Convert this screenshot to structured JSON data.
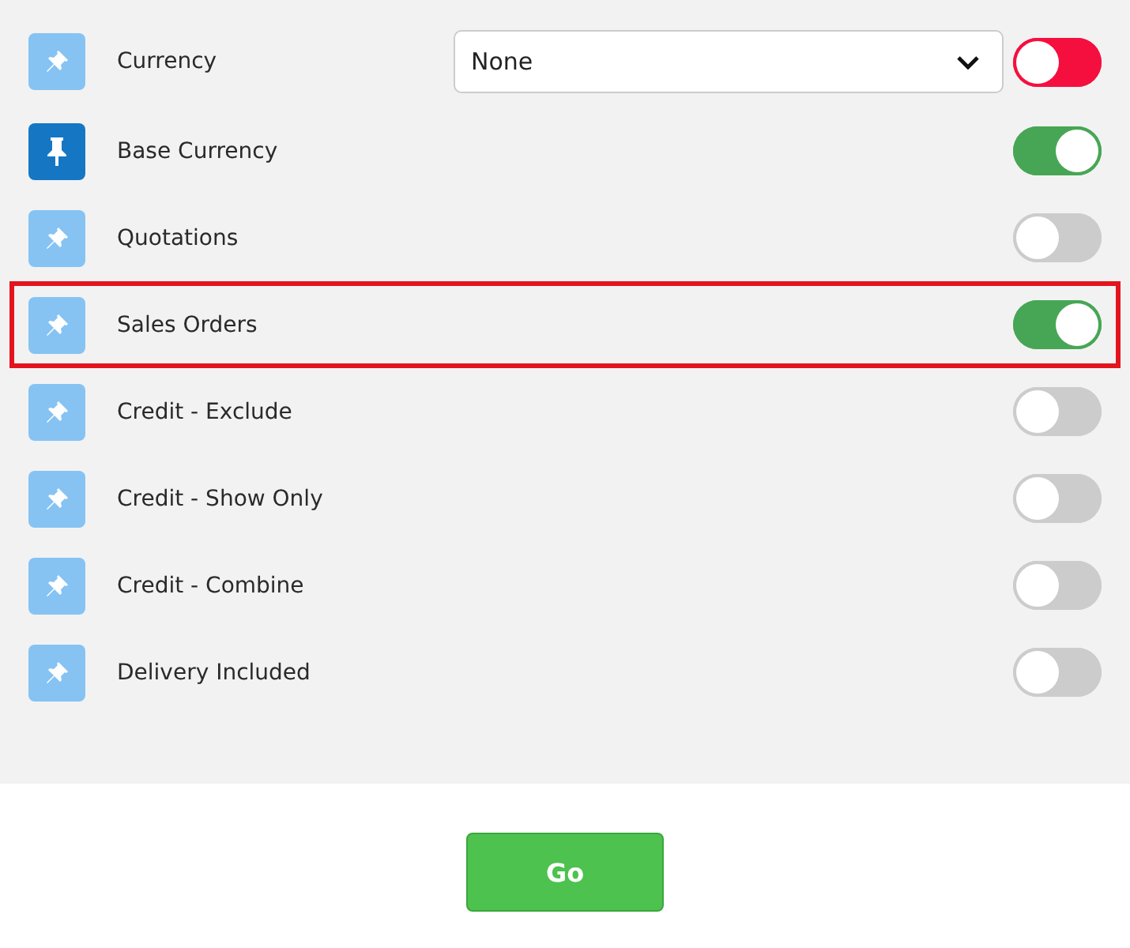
{
  "rows": [
    {
      "kind": "select",
      "label": "Currency",
      "pinned": false,
      "highlighted": false,
      "select": {
        "value": "None"
      },
      "on": false,
      "invalid": true
    },
    {
      "kind": "toggle",
      "label": "Base Currency",
      "pinned": true,
      "highlighted": false,
      "on": true,
      "invalid": false
    },
    {
      "kind": "toggle",
      "label": "Quotations",
      "pinned": false,
      "highlighted": false,
      "on": false,
      "invalid": false
    },
    {
      "kind": "toggle",
      "label": "Sales Orders",
      "pinned": false,
      "highlighted": true,
      "on": true,
      "invalid": false
    },
    {
      "kind": "toggle",
      "label": "Credit - Exclude",
      "pinned": false,
      "highlighted": false,
      "on": false,
      "invalid": false
    },
    {
      "kind": "toggle",
      "label": "Credit - Show Only",
      "pinned": false,
      "highlighted": false,
      "on": false,
      "invalid": false
    },
    {
      "kind": "toggle",
      "label": "Credit - Combine",
      "pinned": false,
      "highlighted": false,
      "on": false,
      "invalid": false
    },
    {
      "kind": "toggle",
      "label": "Delivery Included",
      "pinned": false,
      "highlighted": false,
      "on": false,
      "invalid": false
    }
  ],
  "go_button": {
    "label": "Go"
  }
}
